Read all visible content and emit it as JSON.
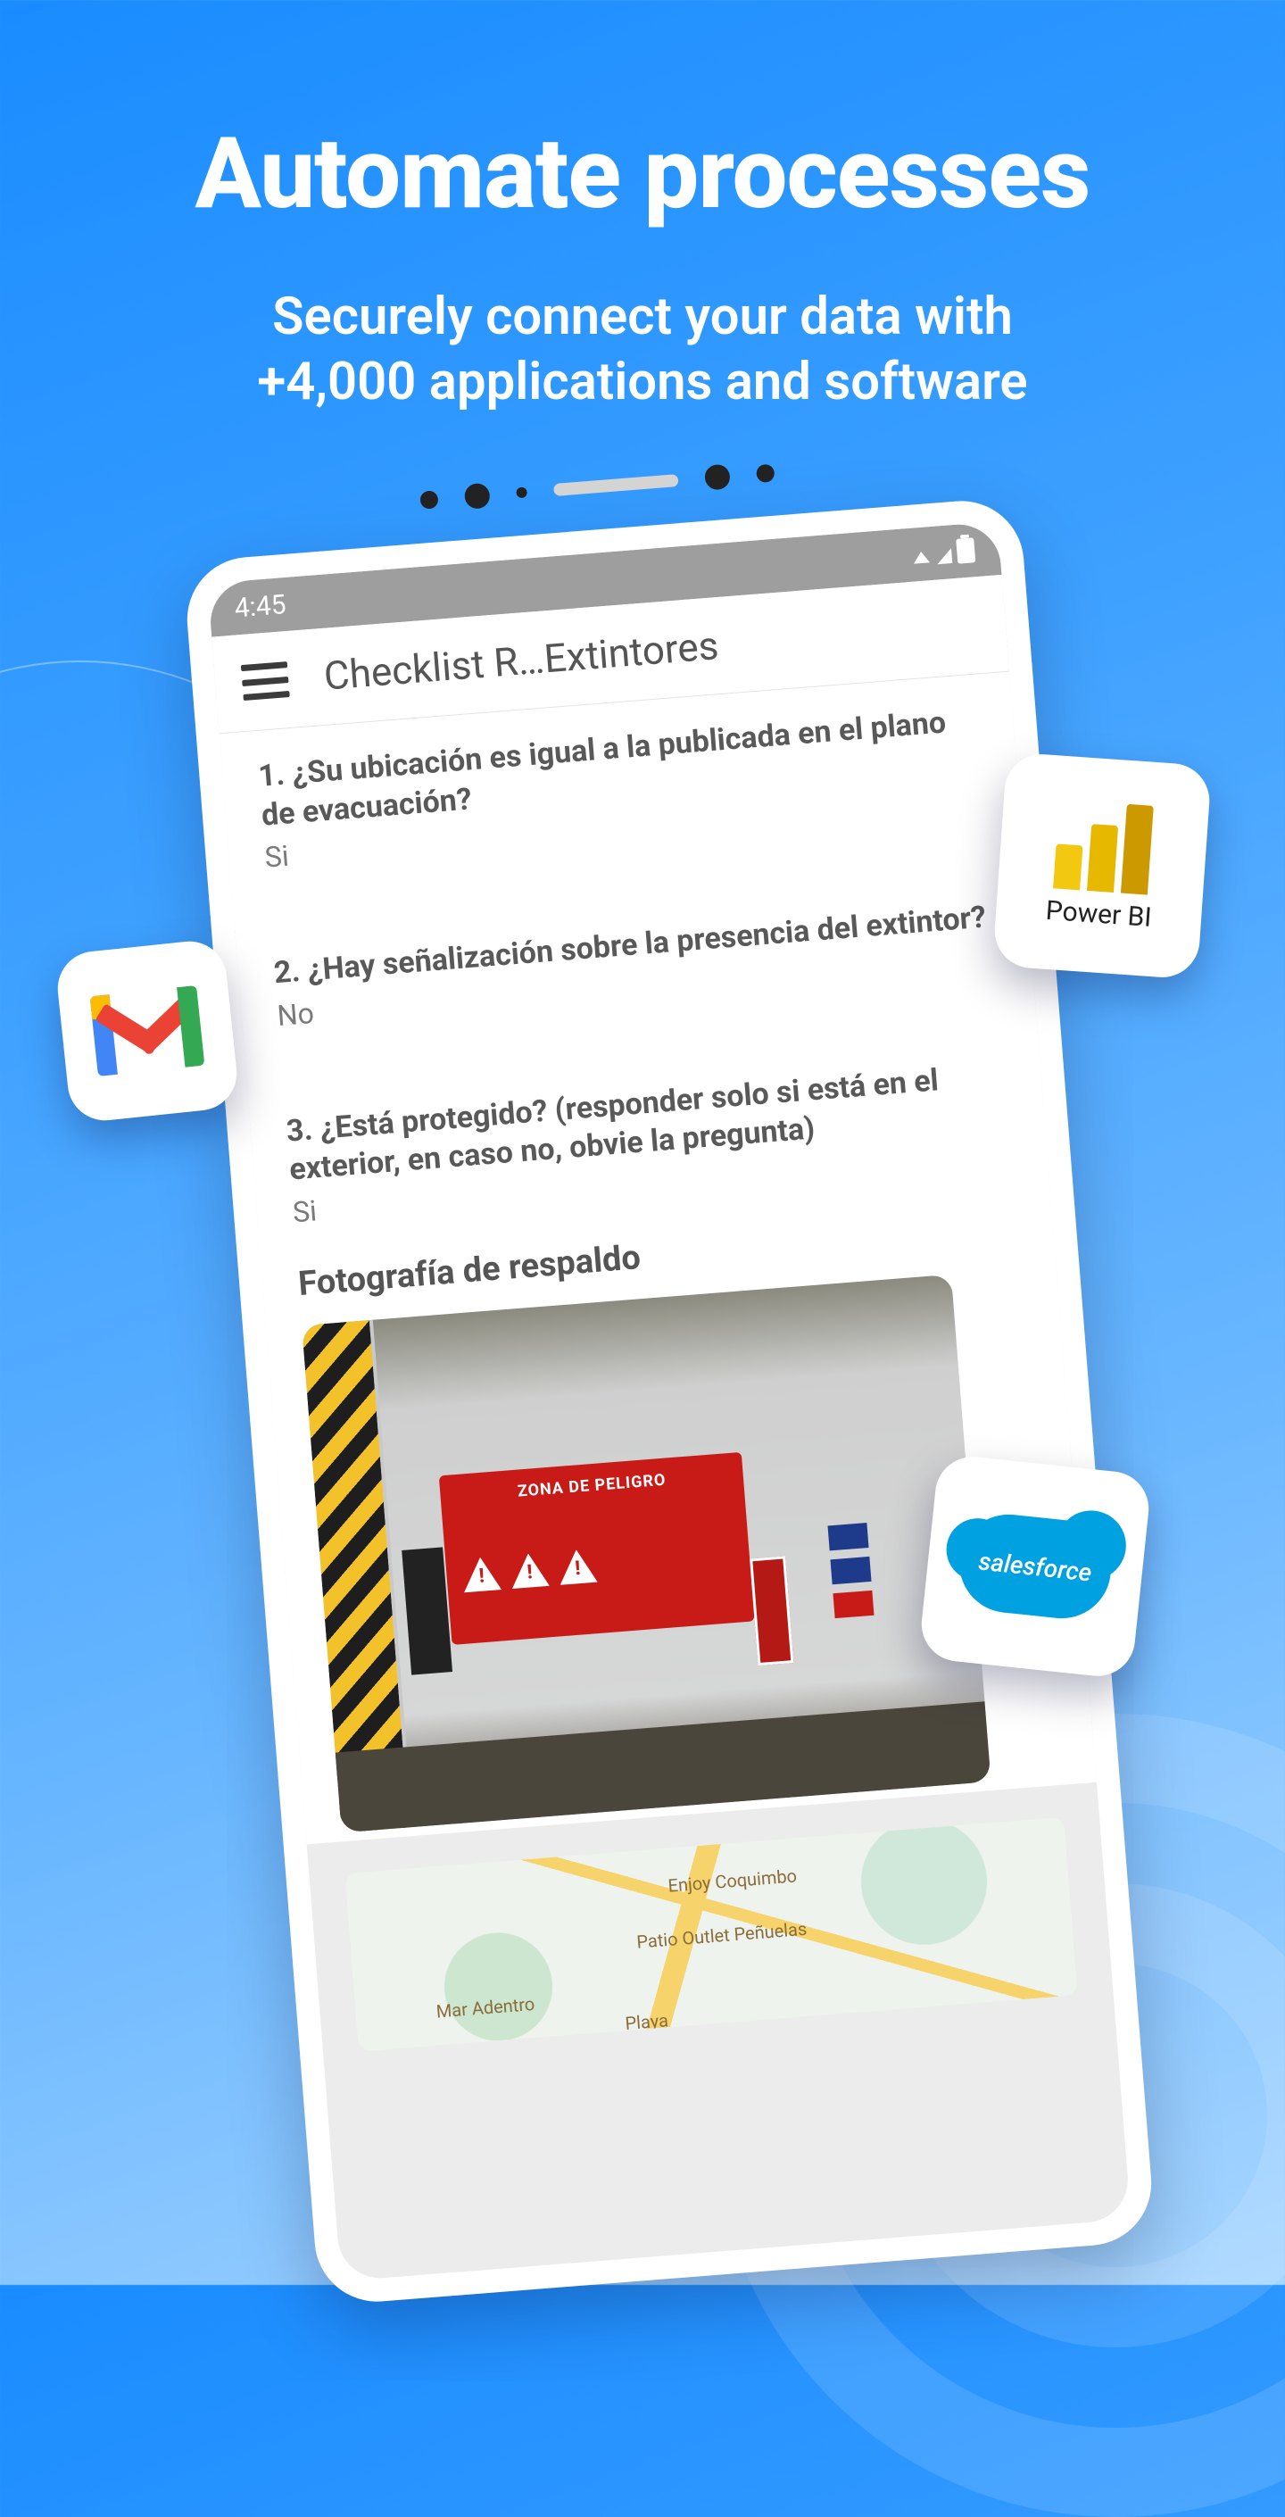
{
  "hero": {
    "title": "Automate processes",
    "subtitle_line1": "Securely connect your data with",
    "subtitle_line2": "+4,000 applications and software"
  },
  "phone": {
    "status_time": "4:45",
    "app_title": "Checklist R…Extintores",
    "questions": [
      {
        "text": "1. ¿Su ubicación es igual a la publicada en el plano de evacuación?",
        "answer": "Si"
      },
      {
        "text": "2. ¿Hay señalización sobre la presencia del extintor?",
        "answer": "No"
      },
      {
        "text": "3. ¿Está protegido? (responder solo si está en el exterior, en caso no, obvie la pregunta)",
        "answer": "Si"
      }
    ],
    "photo_section_label": "Fotografía de respaldo",
    "red_sign_text": "ZONA DE PELIGRO",
    "map_labels": [
      "Enjoy Coquimbo",
      "Patio Outlet Peñuelas",
      "Mar Adentro",
      "Playa"
    ]
  },
  "badges": {
    "powerbi_caption": "Power BI",
    "salesforce_text": "salesforce"
  }
}
